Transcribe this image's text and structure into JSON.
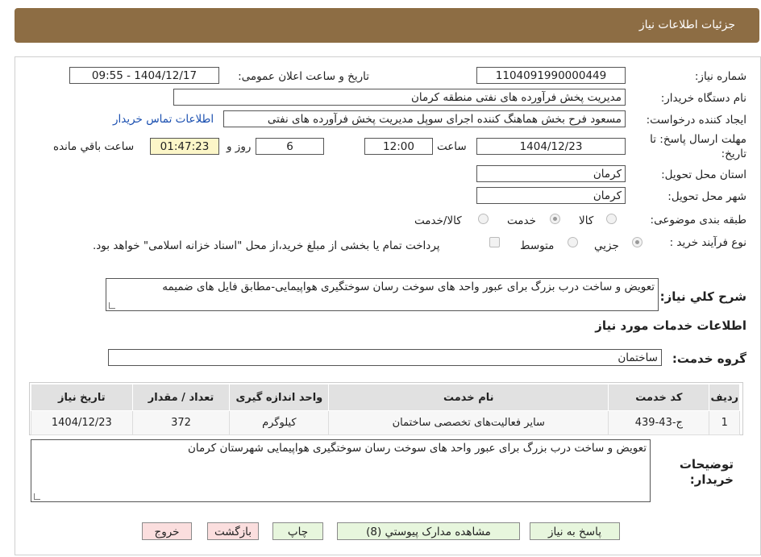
{
  "header": {
    "title": "جزئیات اطلاعات نیاز"
  },
  "fields": {
    "need_number_label": "شماره نیاز:",
    "need_number": "1104091990000449",
    "announce_label": "تاریخ و ساعت اعلان عمومی:",
    "announce_value": "1404/12/17 - 09:55",
    "buyer_org_label": "نام دستگاه خریدار:",
    "buyer_org": "مدیریت پخش فرآورده های نفتی منطقه کرمان",
    "requester_label": "ایجاد کننده درخواست:",
    "requester": "مسعود فرح بخش هماهنگ کننده اجرای سوپل مدیریت پخش فرآورده های نفتی",
    "contact_link": "اطلاعات تماس خریدار",
    "deadline_label_1": "مهلت ارسال پاسخ: تا",
    "deadline_label_2": "تاریخ:",
    "deadline_date": "1404/12/23",
    "time_label": "ساعت",
    "deadline_time": "12:00",
    "days": "6",
    "days_label": "روز و",
    "remaining": "01:47:23",
    "remaining_label": "ساعت باقي مانده",
    "province_label": "استان محل تحویل:",
    "province": "کرمان",
    "city_label": "شهر محل تحویل:",
    "city": "کرمان",
    "category_label": "طبقه بندی موضوعی:",
    "category_options": [
      "کالا",
      "خدمت",
      "کالا/خدمت"
    ],
    "process_label": "نوع فرآیند خرید :",
    "process_options": [
      "جزیي",
      "متوسط"
    ],
    "payment_note": "پرداخت تمام یا بخشی از مبلغ خرید،از محل \"اسناد خزانه اسلامی\" خواهد بود."
  },
  "summary": {
    "label": "شرح کلي نیاز:",
    "text": "تعویض و ساخت درب بزرگ برای عبور واحد های سوخت رسان سوختگیری هواپیمایی-مطابق فایل های ضمیمه"
  },
  "services": {
    "section_title": "اطلاعات خدمات مورد نیاز",
    "group_label": "گروه خدمت:",
    "group_value": "ساختمان",
    "columns": [
      "ردیف",
      "کد خدمت",
      "نام خدمت",
      "واحد اندازه گیری",
      "تعداد / مقدار",
      "تاریخ نیاز"
    ],
    "rows": [
      [
        "1",
        "ج-43-439",
        "سایر فعالیت‌های تخصصی ساختمان",
        "کیلوگرم",
        "372",
        "1404/12/23"
      ]
    ]
  },
  "buyer_notes": {
    "label_1": "توضیحات",
    "label_2": "خریدار:",
    "text": "تعویض و ساخت درب بزرگ برای عبور واحد های سوخت رسان سوختگیری هواپیمایی شهرستان کرمان"
  },
  "buttons": {
    "respond": "پاسخ به نیاز",
    "documents": "مشاهده مدارک پیوستي (8)",
    "print": "چاپ",
    "back": "بازگشت",
    "exit": "خروج"
  },
  "colors": {
    "header": "#8d6d44",
    "green_button": "#e7f6dd",
    "pink_button": "#fbdede",
    "timer_bg": "#fcf6c8"
  }
}
